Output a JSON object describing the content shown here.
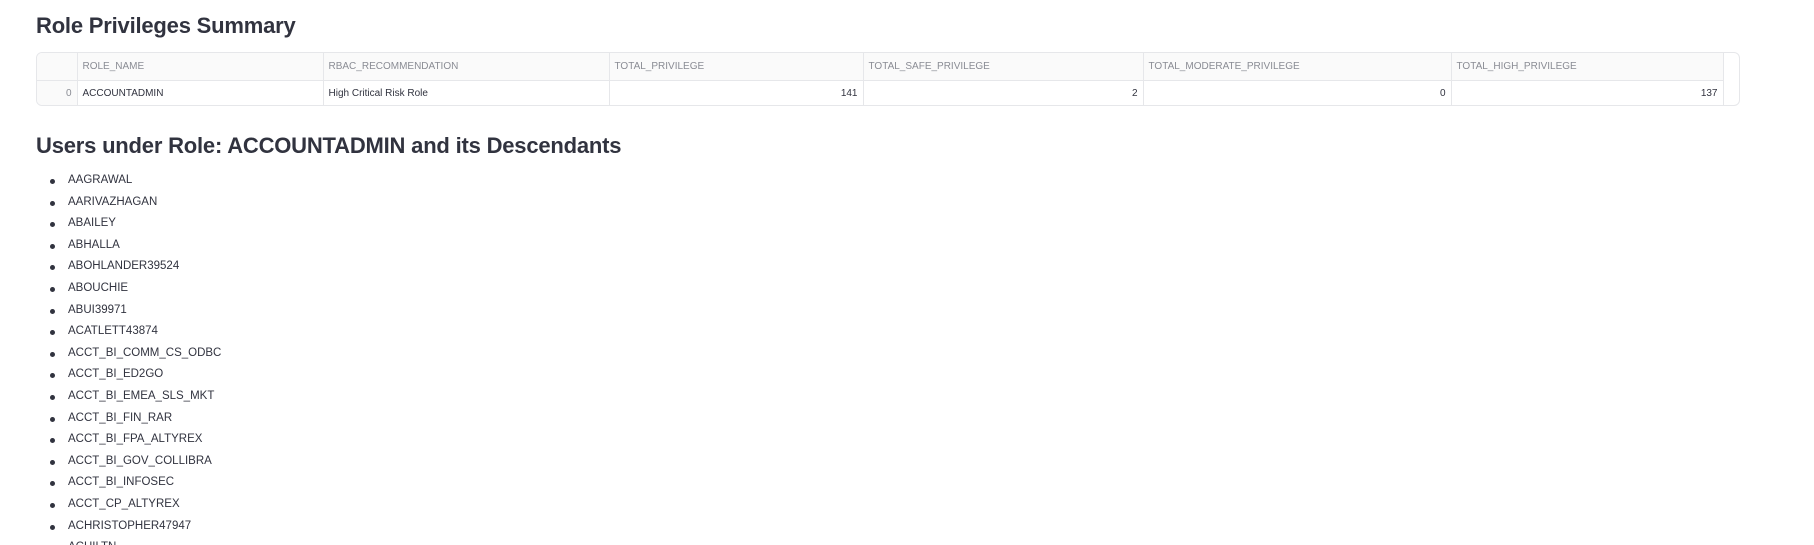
{
  "summary": {
    "title": "Role Privileges Summary",
    "columns": [
      "",
      "ROLE_NAME",
      "RBAC_RECOMMENDATION",
      "TOTAL_PRIVILEGE",
      "TOTAL_SAFE_PRIVILEGE",
      "TOTAL_MODERATE_PRIVILEGE",
      "TOTAL_HIGH_PRIVILEGE"
    ],
    "rows": [
      {
        "index": "0",
        "role_name": "ACCOUNTADMIN",
        "rbac_recommendation": "High Critical Risk Role",
        "total_privilege": "141",
        "total_safe_privilege": "2",
        "total_moderate_privilege": "0",
        "total_high_privilege": "137"
      }
    ]
  },
  "users": {
    "title": "Users under Role: ACCOUNTADMIN and its Descendants",
    "items": [
      "AAGRAWAL",
      "AARIVAZHAGAN",
      "ABAILEY",
      "ABHALLA",
      "ABOHLANDER39524",
      "ABOUCHIE",
      "ABUI39971",
      "ACATLETT43874",
      "ACCT_BI_COMM_CS_ODBC",
      "ACCT_BI_ED2GO",
      "ACCT_BI_EMEA_SLS_MKT",
      "ACCT_BI_FIN_RAR",
      "ACCT_BI_FPA_ALTYREX",
      "ACCT_BI_GOV_COLLIBRA",
      "ACCT_BI_INFOSEC",
      "ACCT_CP_ALTYREX",
      "ACHRISTOPHER47947",
      "ACHILTN"
    ]
  }
}
